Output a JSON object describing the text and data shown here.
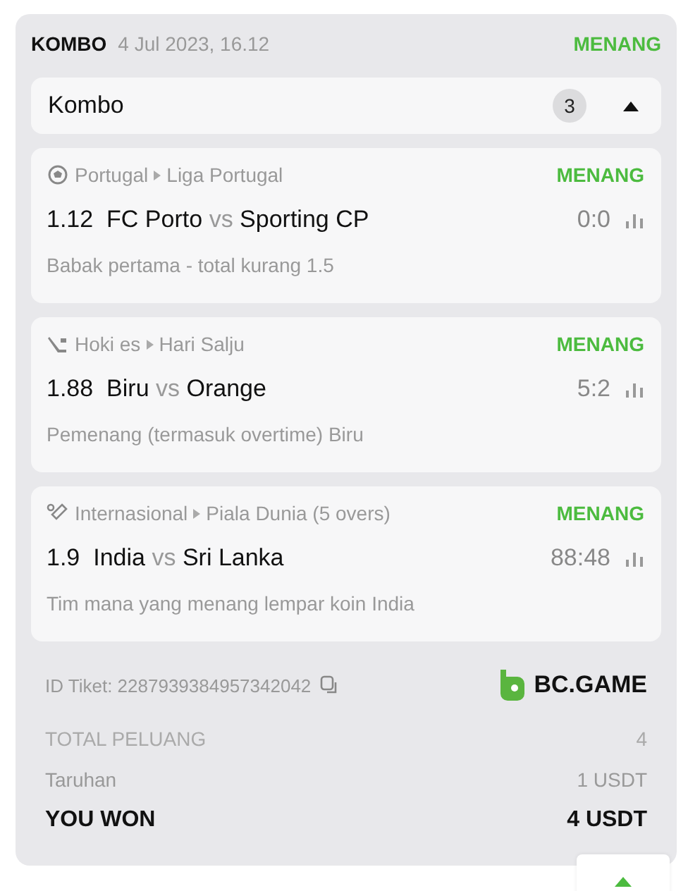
{
  "header": {
    "type": "KOMBO",
    "date": "4 Jul 2023, 16.12",
    "status": "MENANG"
  },
  "group": {
    "title": "Kombo",
    "count": "3",
    "expanded": true
  },
  "bets": [
    {
      "kind": "soccer",
      "country": "Portugal",
      "league": "Liga Portugal",
      "status": "MENANG",
      "odds": "1.12",
      "home": "FC Porto",
      "vs": "vs",
      "away": "Sporting CP",
      "score": "0:0",
      "market": "Babak pertama - total kurang 1.5"
    },
    {
      "kind": "hockey",
      "country": "Hoki es",
      "league": "Hari Salju",
      "status": "MENANG",
      "odds": "1.88",
      "home": "Biru",
      "vs": "vs",
      "away": "Orange",
      "score": "5:2",
      "market": "Pemenang (termasuk overtime) Biru"
    },
    {
      "kind": "cricket",
      "country": "Internasional",
      "league": "Piala Dunia (5 overs)",
      "status": "MENANG",
      "odds": "1.9",
      "home": "India",
      "vs": "vs",
      "away": "Sri Lanka",
      "score": "88:48",
      "market": "Tim mana yang menang lempar koin India"
    }
  ],
  "ticket": {
    "id": "ID Tiket: 2287939384957342042",
    "brand": "BC.GAME"
  },
  "totals": [
    {
      "kind": "muted",
      "label": "TOTAL PELUANG",
      "value": "4"
    },
    {
      "kind": "normal",
      "label": "Taruhan",
      "value": "1 USDT"
    },
    {
      "kind": "strong",
      "label": "YOU WON",
      "value": "4 USDT"
    }
  ]
}
